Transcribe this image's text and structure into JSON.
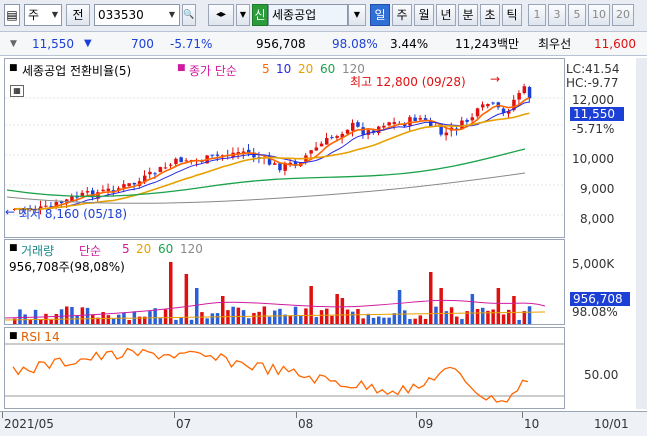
{
  "toolbar": {
    "market_select": "주",
    "prefix_btn": "전",
    "code_input": "033530",
    "company_badge": "신",
    "company_name": "세종공업",
    "period_buttons": [
      "일",
      "주",
      "월",
      "년",
      "분",
      "초",
      "틱"
    ],
    "selected_period": "일",
    "interval_buttons": [
      "1",
      "3",
      "5",
      "10",
      "20"
    ]
  },
  "quote": {
    "price": "11,550",
    "change_arrow": "▼",
    "change": "700",
    "change_pct": "-5.71%",
    "volume": "956,708",
    "volume_ratio": "98.08%",
    "turnover_pct": "3.44%",
    "trade_value": "11,243백만",
    "best_ask_label": "최우선",
    "best_ask": "11,600"
  },
  "price_pane": {
    "title": "세종공업 전환비율(5)",
    "legend_label": "종가 단순",
    "ma_periods": [
      "5",
      "10",
      "20",
      "60",
      "120"
    ],
    "ma_colors": [
      "#ff6600",
      "#2a2adf",
      "#e8a000",
      "#1aa34a",
      "#888888"
    ],
    "high_annot": "최고 12,800 (09/28)",
    "low_annot": "최저 8,160 (05/18)",
    "lc": "LC:41.54",
    "hc": "HC:-9.77",
    "current_price_tag": "11,550",
    "current_pct_tag": "-5.71%",
    "y_ticks": [
      "12,000",
      "10,000",
      "9,000",
      "8,000"
    ]
  },
  "volume_pane": {
    "title": "거래량",
    "legend_label": "단순",
    "ma_periods": [
      "5",
      "20",
      "60",
      "120"
    ],
    "volume_value": "956,708주(98,08%)",
    "y_tick": "5,000K",
    "current_tag": "956,708",
    "pct_tag": "98.08%"
  },
  "rsi_pane": {
    "title": "RSI 14",
    "y_tick": "50.00"
  },
  "x_axis": {
    "labels": [
      "2021/05",
      "07",
      "08",
      "09",
      "10"
    ],
    "right_label": "10/01"
  },
  "colors": {
    "up": "#e01010",
    "down": "#1c3fd6",
    "rsi": "#ff6600",
    "accent": "#2f6fd6"
  }
}
